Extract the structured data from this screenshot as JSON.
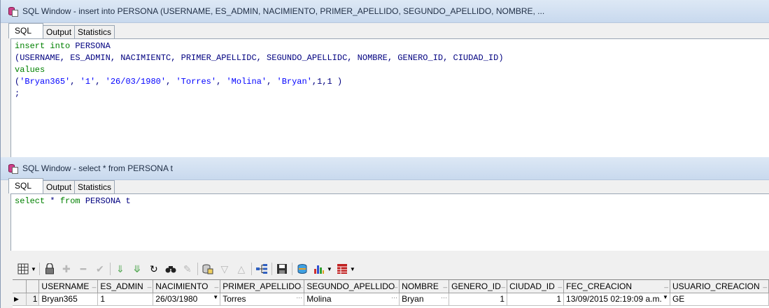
{
  "window1": {
    "title": "SQL Window - insert into PERSONA (USERNAME, ES_ADMIN, NACIMIENTO, PRIMER_APELLIDO, SEGUNDO_APELLIDO, NOMBRE,  ...",
    "tabs": [
      "SQL",
      "Output",
      "Statistics"
    ],
    "code": {
      "l1_kw": "insert into",
      "l1_id": " PERSONA",
      "l2": "(USERNAME, ES_ADMIN, NACIMIENTC, PRIMER_APELLIDC, SEGUNDO_APELLIDC, NOMBRE, GENERO_ID, CIUDAD_ID)",
      "l3_kw": "values",
      "l4_open": "(",
      "l4_s1": "'Bryan365'",
      "l4_s2": "'1'",
      "l4_s3": "'26/03/1980'",
      "l4_s4": "'Torres'",
      "l4_s5": "'Molina'",
      "l4_s6": "'Bryan'",
      "l4_tail": ",1,1 )",
      "sep": ", ",
      "l5": ";"
    }
  },
  "window2": {
    "title": "SQL Window - select * from PERSONA t",
    "tabs": [
      "SQL",
      "Output",
      "Statistics"
    ],
    "code": {
      "kw1": "select",
      "star": " * ",
      "kw2": "from",
      "rest": " PERSONA t"
    },
    "grid": {
      "columns": [
        "USERNAME",
        "ES_ADMIN",
        "NACIMIENTO",
        "PRIMER_APELLIDO",
        "SEGUNDO_APELLIDO",
        "NOMBRE",
        "GENERO_ID",
        "CIUDAD_ID",
        "FEC_CREACION",
        "USUARIO_CREACION"
      ],
      "rows": [
        {
          "indicator": "▶",
          "num": "1",
          "username": "Bryan365",
          "es_admin": "1",
          "nacimiento": "26/03/1980",
          "primer_apellido": "Torres",
          "segundo_apellido": "Molina",
          "nombre": "Bryan",
          "genero_id": "1",
          "ciudad_id": "1",
          "fec_creacion": "13/09/2015 02:19:09 a.m.",
          "usuario_creacion": "GE"
        }
      ]
    }
  },
  "icons": [
    "grid-icon",
    "lock-icon",
    "add-icon",
    "remove-icon",
    "check-icon",
    "down-icon",
    "down-all-icon",
    "refresh-icon",
    "find-icon",
    "clear-icon",
    "query-icon",
    "filter-icon",
    "sort-icon",
    "tree-icon",
    "save-icon",
    "export-icon",
    "chart-icon",
    "table-icon"
  ]
}
